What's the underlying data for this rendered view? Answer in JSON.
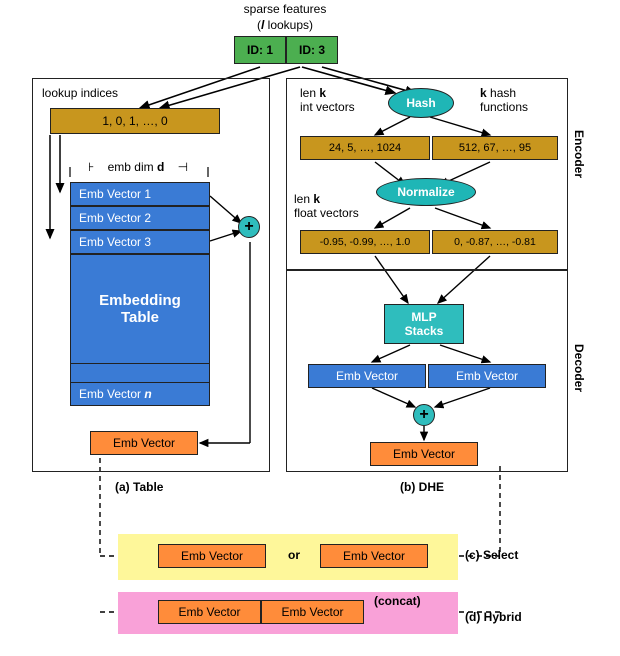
{
  "top": {
    "title": "sparse features",
    "subtitle_prefix": "(",
    "subtitle_var": "l",
    "subtitle_suffix": " lookups)",
    "id1_label": "ID: 1",
    "id3_label": "ID: 3"
  },
  "left": {
    "lookup_title": "lookup indices",
    "lookup_values": "1, 0, 1, …, 0",
    "emb_dim_label": "emb dim d",
    "emb_rows": {
      "r1": "Emb Vector 1",
      "r2": "Emb Vector 2",
      "r3": "Emb Vector 3"
    },
    "table_label": "Embedding\nTable",
    "emb_n": "Emb Vector n",
    "out_emb": "Emb Vector",
    "caption": "(a) Table",
    "plus": "+"
  },
  "right": {
    "hash_label": "Hash",
    "len_k_int": "len k\nint vectors",
    "k_hash": "k hash\nfunctions",
    "hash_out1": "24, 5, …, 1024",
    "hash_out2": "512, 67, …, 95",
    "normalize_label": "Normalize",
    "len_k_float": "len k\nfloat vectors",
    "norm_out1": "-0.95, -0.99, …, 1.0",
    "norm_out2": "0, -0.87, …, -0.81",
    "mlp_label": "MLP\nStacks",
    "mlp_out1": "Emb Vector",
    "mlp_out2": "Emb Vector",
    "plus": "+",
    "out_emb": "Emb Vector",
    "caption": "(b) DHE",
    "encoder": "Encoder",
    "decoder": "Decoder"
  },
  "bottom": {
    "select_emb1": "Emb Vector",
    "select_or": "or",
    "select_emb2": "Emb Vector",
    "select_caption": "(c) Select",
    "hybrid_emb1": "Emb Vector",
    "hybrid_emb2": "Emb Vector",
    "hybrid_concat": "(concat)",
    "hybrid_caption": "(d) Hybrid"
  }
}
